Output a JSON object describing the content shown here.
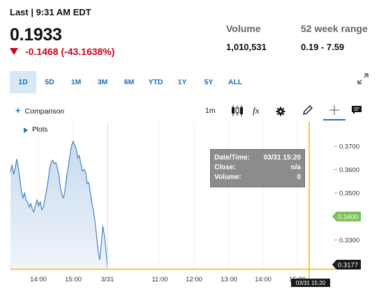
{
  "header": {
    "last_line": "Last | 9:31 AM EDT",
    "price": "0.1933",
    "change": "-0.1468 (-43.1638%)",
    "volume_label": "Volume",
    "volume_value": "1,010,531",
    "range_label": "52 week range",
    "range_value": "0.19 - 7.59"
  },
  "range_buttons": [
    "1D",
    "5D",
    "1M",
    "3M",
    "6M",
    "YTD",
    "1Y",
    "5Y",
    "ALL"
  ],
  "active_range": "1D",
  "toolbar": {
    "comparison_label": "Comparison",
    "interval_label": "1m",
    "fx_label": "fx"
  },
  "plots_label": "Plots",
  "tooltip": {
    "datetime_label": "Date/Time:",
    "datetime_value": "03/31 15:20",
    "close_label": "Close:",
    "close_value": "n/a",
    "volume_label": "Volume:",
    "volume_value": "0"
  },
  "colors": {
    "line": "#3a78c0",
    "area": "#c9dbee",
    "crosshair": "#f5b700",
    "down": "#d0021b",
    "accent": "#1f6fb7",
    "green_label": "#7cbf5a",
    "dark_label": "#1a1a1a"
  },
  "chart_data": {
    "type": "line",
    "title": "",
    "xlabel": "",
    "ylabel": "",
    "x_ticks": [
      "14:00",
      "15:00",
      "3/31",
      "11:00",
      "12:00",
      "13:00",
      "14:00",
      "15:00"
    ],
    "y_ticks": [
      0.37,
      0.36,
      0.35,
      0.34,
      0.33
    ],
    "y_tick_labels": [
      "0.3700",
      "0.3600",
      "0.3500",
      "0.3400",
      "0.3300"
    ],
    "ylim": [
      0.3177,
      0.3732
    ],
    "series": [
      {
        "values": [
          [
            0,
            0.359
          ],
          [
            1,
            0.362
          ],
          [
            2,
            0.358
          ],
          [
            3,
            0.3605
          ],
          [
            4,
            0.3645
          ],
          [
            5,
            0.361
          ],
          [
            6,
            0.356
          ],
          [
            7,
            0.351
          ],
          [
            8,
            0.348
          ],
          [
            9,
            0.35
          ],
          [
            10,
            0.347
          ],
          [
            11,
            0.346
          ],
          [
            12,
            0.344
          ],
          [
            13,
            0.3455
          ],
          [
            14,
            0.343
          ],
          [
            15,
            0.342
          ],
          [
            16,
            0.345
          ],
          [
            17,
            0.347
          ],
          [
            18,
            0.3445
          ],
          [
            19,
            0.3465
          ],
          [
            20,
            0.343
          ],
          [
            21,
            0.344
          ],
          [
            22,
            0.3475
          ],
          [
            23,
            0.351
          ],
          [
            24,
            0.355
          ],
          [
            25,
            0.36
          ],
          [
            26,
            0.363
          ],
          [
            27,
            0.364
          ],
          [
            28,
            0.3625
          ],
          [
            29,
            0.363
          ],
          [
            30,
            0.3605
          ],
          [
            31,
            0.3575
          ],
          [
            32,
            0.352
          ],
          [
            33,
            0.349
          ],
          [
            34,
            0.348
          ],
          [
            35,
            0.352
          ],
          [
            36,
            0.3575
          ],
          [
            37,
            0.3615
          ],
          [
            38,
            0.366
          ],
          [
            39,
            0.37
          ],
          [
            40,
            0.372
          ],
          [
            41,
            0.3705
          ],
          [
            42,
            0.369
          ],
          [
            43,
            0.365
          ],
          [
            44,
            0.366
          ],
          [
            45,
            0.3625
          ],
          [
            46,
            0.3595
          ],
          [
            47,
            0.36
          ],
          [
            48,
            0.359
          ],
          [
            49,
            0.354
          ],
          [
            50,
            0.3545
          ],
          [
            51,
            0.3505
          ],
          [
            52,
            0.346
          ],
          [
            53,
            0.3425
          ],
          [
            54,
            0.338
          ],
          [
            55,
            0.332
          ],
          [
            56,
            0.3255
          ],
          [
            57,
            0.3215
          ],
          [
            58,
            0.328
          ],
          [
            59,
            0.336
          ],
          [
            60,
            0.332
          ],
          [
            61,
            0.326
          ],
          [
            62,
            0.318
          ]
        ]
      }
    ],
    "last_close_label": "0.3400",
    "last_price_label": "0.3177",
    "crosshair_x_label": "03/31 15:20",
    "grid": "vertical",
    "legend": "none"
  }
}
